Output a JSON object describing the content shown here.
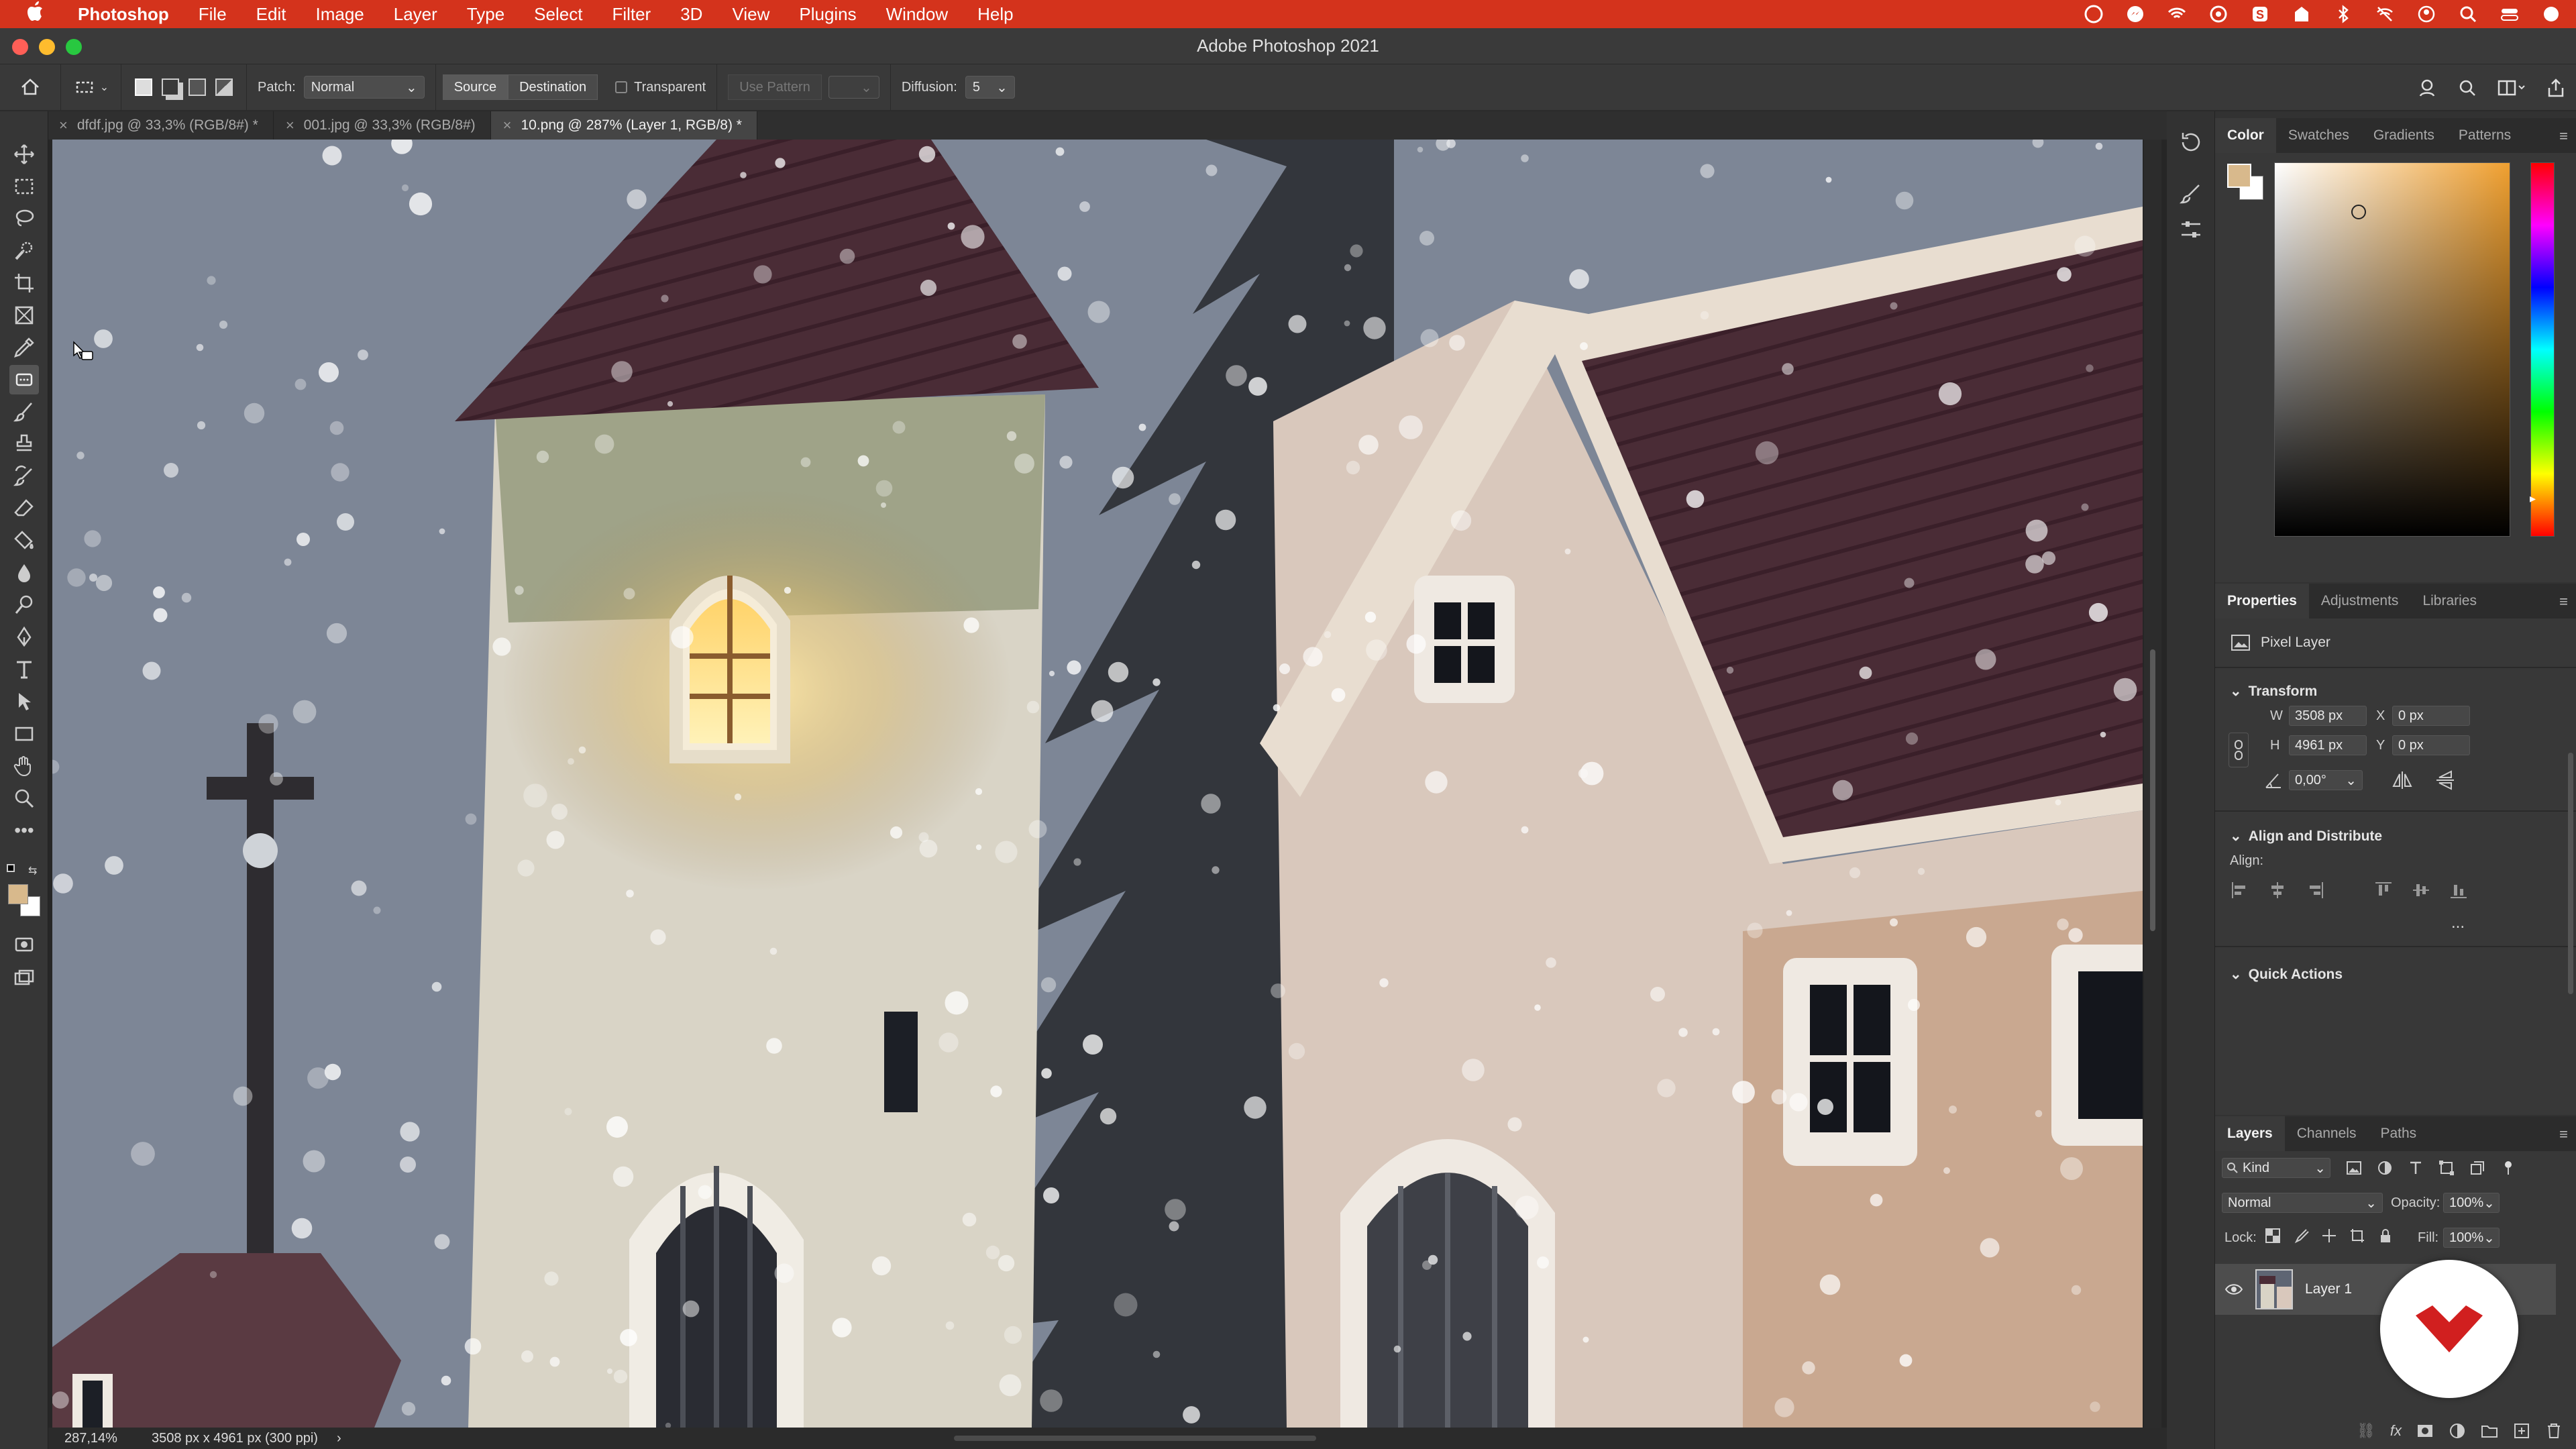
{
  "menubar": {
    "apple": "",
    "app": "Photoshop",
    "items": [
      "File",
      "Edit",
      "Image",
      "Layer",
      "Type",
      "Select",
      "Filter",
      "3D",
      "View",
      "Plugins",
      "Window",
      "Help"
    ]
  },
  "window": {
    "title": "Adobe Photoshop 2021"
  },
  "options": {
    "patch_label": "Patch:",
    "patch_mode": "Normal",
    "source": "Source",
    "destination": "Destination",
    "transparent": "Transparent",
    "use_pattern": "Use Pattern",
    "diffusion_label": "Diffusion:",
    "diffusion_value": "5"
  },
  "tabs": [
    {
      "label": "dfdf.jpg @ 33,3% (RGB/8#) *",
      "active": false
    },
    {
      "label": "001.jpg @ 33,3% (RGB/8#)",
      "active": false
    },
    {
      "label": "10.png @ 287% (Layer 1, RGB/8) *",
      "active": true
    }
  ],
  "status": {
    "zoom": "287,14%",
    "doc_info": "3508 px x 4961 px (300 ppi)",
    "arrow": "›"
  },
  "color_panel": {
    "tabs": [
      "Color",
      "Swatches",
      "Gradients",
      "Patterns"
    ],
    "foreground": "#d8b98c",
    "background": "#ffffff",
    "hue": "#f0a030"
  },
  "properties_panel": {
    "tabs": [
      "Properties",
      "Adjustments",
      "Libraries"
    ],
    "layer_type": "Pixel Layer",
    "transform": {
      "title": "Transform",
      "w_label": "W",
      "w": "3508 px",
      "x_label": "X",
      "x": "0 px",
      "h_label": "H",
      "h": "4961 px",
      "y_label": "Y",
      "y": "0 px",
      "angle": "0,00°"
    },
    "align": {
      "title": "Align and Distribute",
      "label": "Align:",
      "more": "..."
    },
    "quick_actions": {
      "title": "Quick Actions"
    }
  },
  "layers_panel": {
    "tabs": [
      "Layers",
      "Channels",
      "Paths"
    ],
    "filter": "Kind",
    "blend_mode": "Normal",
    "opacity_label": "Opacity:",
    "opacity": "100%",
    "lock_label": "Lock:",
    "fill_label": "Fill:",
    "fill": "100%",
    "layers": [
      {
        "name": "Layer 1",
        "visible": true
      }
    ]
  }
}
